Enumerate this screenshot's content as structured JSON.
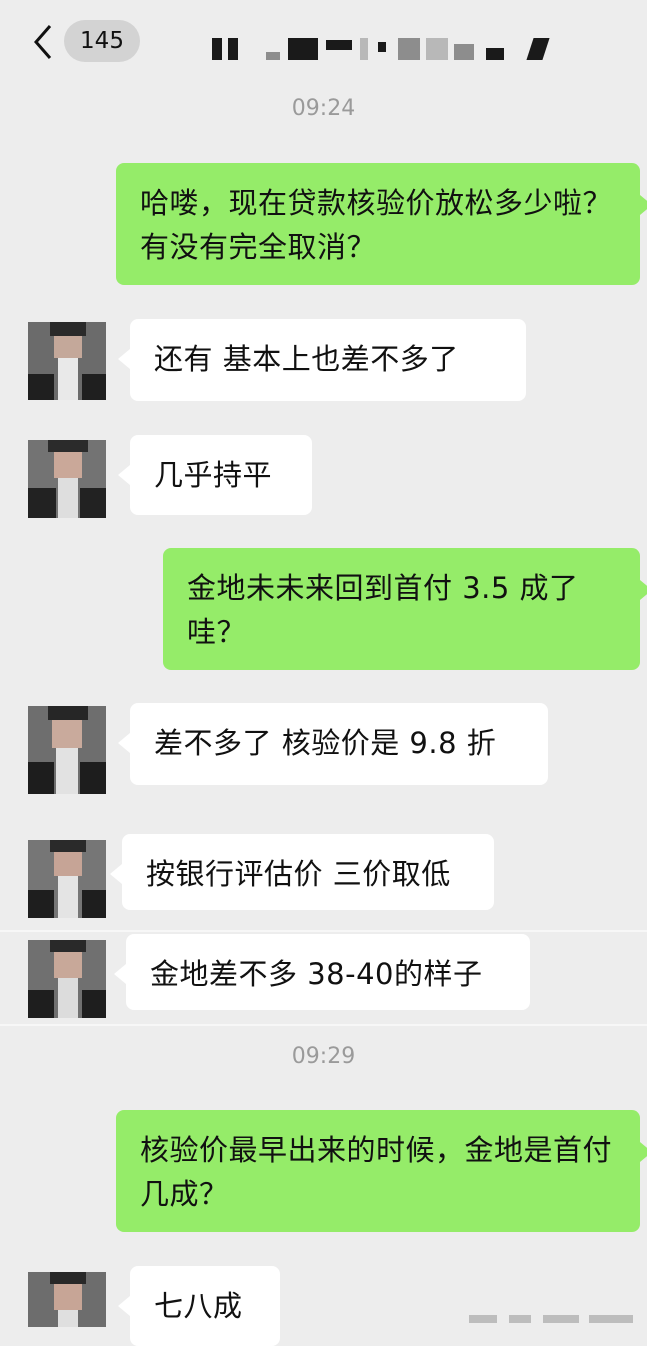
{
  "header": {
    "back_icon": "chevron-left-icon",
    "unread_count": "145"
  },
  "timestamps": {
    "first": "09:24",
    "second": "09:29"
  },
  "messages": [
    {
      "sender": "me",
      "text": "哈喽，现在贷款核验价放松多少啦？有没有完全取消？"
    },
    {
      "sender": "them",
      "text": "还有 基本上也差不多了"
    },
    {
      "sender": "them",
      "text": "几乎持平"
    },
    {
      "sender": "me",
      "text": "金地未未来回到首付 3.5 成了哇？"
    },
    {
      "sender": "them",
      "text": "差不多了 核验价是 9.8 折"
    },
    {
      "sender": "them",
      "text": "按银行评估价 三价取低"
    },
    {
      "sender": "them",
      "text": "金地差不多 38-40的样子"
    },
    {
      "sender": "me",
      "text": "核验价最早出来的时候，金地是首付几成？"
    },
    {
      "sender": "them",
      "text": "七八成"
    }
  ],
  "colors": {
    "background": "#ededed",
    "my_bubble": "#95ec69",
    "their_bubble": "#ffffff",
    "timestamp_text": "#9a9a9a"
  }
}
